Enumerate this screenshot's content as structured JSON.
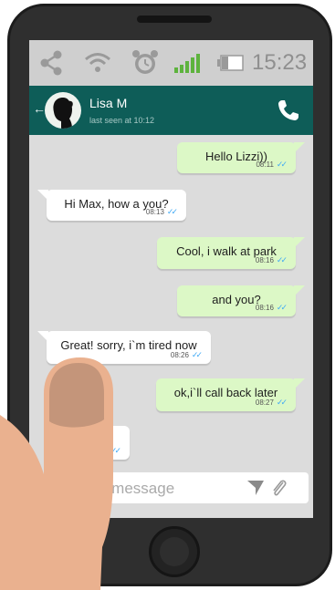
{
  "status_bar": {
    "icons": [
      "share-icon",
      "wifi-icon",
      "alarm-icon",
      "signal-icon",
      "battery-icon"
    ],
    "time": "15:23"
  },
  "header": {
    "back_glyph": "←",
    "contact_name": "Lisa M",
    "last_seen": "last seen at 10:12",
    "colors": {
      "bar": "#0e5d58"
    }
  },
  "messages": [
    {
      "dir": "out",
      "text": "Hello Lizzi))",
      "time": "08:11"
    },
    {
      "dir": "in",
      "text": "Hi Max, how a you?",
      "time": "08:13"
    },
    {
      "dir": "out",
      "text": "Cool, i walk at park",
      "time": "08:16"
    },
    {
      "dir": "out",
      "text": "and you?",
      "time": "08:16"
    },
    {
      "dir": "in",
      "text": "Great! sorry, i`m tired now",
      "time": "08:26"
    },
    {
      "dir": "out",
      "text": "ok,i`ll call back later",
      "time": "08:27"
    },
    {
      "dir": "in",
      "text": "",
      "time": "3"
    }
  ],
  "composer": {
    "placeholder": "a message",
    "icons": [
      "send-icon",
      "paperclip-icon"
    ]
  },
  "colors": {
    "outgoing_bubble": "#dcf8c6",
    "incoming_bubble": "#ffffff",
    "read_ticks": "#3fa9f5",
    "chat_bg": "#dcdcdc"
  }
}
